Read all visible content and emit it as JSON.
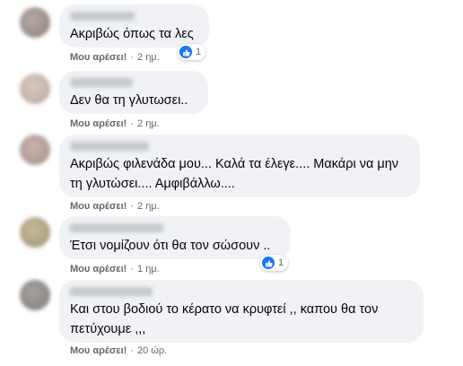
{
  "comments": [
    {
      "text": "Ακριβώς όπως τα λες",
      "like_label": "Μου αρέσει!",
      "separator": "·",
      "time": "2 ημ.",
      "reactions": "1"
    },
    {
      "text": "Δεν θα τη γλυτωσει..",
      "like_label": "Μου αρέσει!",
      "separator": "·",
      "time": "2 ημ."
    },
    {
      "text": "Ακριβώς φιλενάδα μου... Καλά τα έλεγε.... Μακάρι να μην τη γλυτώσει.... Αμφιβάλλω....",
      "like_label": "Μου αρέσει!",
      "separator": "·",
      "time": "2 ημ."
    },
    {
      "text": "Έτσι νομίζουν ότι θα τον σώσουν ..",
      "like_label": "Μου αρέσει!",
      "separator": "·",
      "time": "1 ημ.",
      "reactions": "1"
    },
    {
      "text": "Και στου βοδιού το κέρατο να κρυφτεί ,, καπου θα τον πετύχουμε ,,,",
      "like_label": "Μου αρέσει!",
      "separator": "·",
      "time": "20 ώρ."
    }
  ],
  "colors": {
    "bubble": "#f0f2f5",
    "like_blue": "#1877f2",
    "meta_gray": "#65676b"
  },
  "icons": {
    "reaction": "thumbs-up-icon"
  }
}
